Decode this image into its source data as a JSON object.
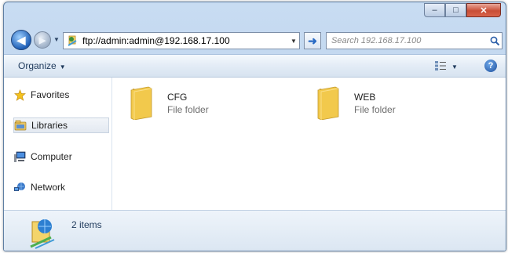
{
  "window": {
    "caption_buttons": {
      "minimize": "–",
      "maximize": "□",
      "close": "✕"
    }
  },
  "nav": {
    "back_icon": "back-arrow-icon",
    "forward_icon": "forward-arrow-icon",
    "address": "ftp://admin:admin@192.168.17.100",
    "search_placeholder": "Search 192.168.17.100"
  },
  "toolbar": {
    "organize_label": "Organize",
    "help_label": "?"
  },
  "sidebar": {
    "items": [
      {
        "label": "Favorites",
        "icon": "star-icon"
      },
      {
        "label": "Libraries",
        "icon": "libraries-icon"
      },
      {
        "label": "Computer",
        "icon": "computer-icon"
      },
      {
        "label": "Network",
        "icon": "network-icon"
      }
    ]
  },
  "folders": [
    {
      "name": "CFG",
      "type": "File folder"
    },
    {
      "name": "WEB",
      "type": "File folder"
    }
  ],
  "details": {
    "item_count": "2 items"
  },
  "colors": {
    "titlebar": "#c8dcf2",
    "close_button": "#c94e36",
    "folder": "#f2c94c"
  }
}
